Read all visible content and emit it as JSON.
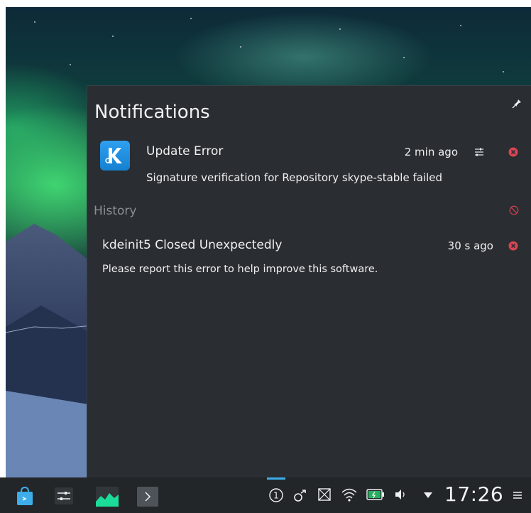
{
  "panel": {
    "title": "Notifications"
  },
  "notifications": [
    {
      "title": "Update Error",
      "time": "2 min ago",
      "body": "Signature verification for Repository skype-stable failed",
      "icon": "kde-discover-icon"
    }
  ],
  "history": {
    "label": "History",
    "items": [
      {
        "title": "kdeinit5 Closed Unexpectedly",
        "time": "30 s ago",
        "body": "Please report this error to help improve this software."
      }
    ]
  },
  "taskbar": {
    "clock": "17:26",
    "launchers": [
      "app-store-icon",
      "settings-sliders-icon",
      "system-monitor-icon",
      "terminal-icon"
    ],
    "tray": [
      "notification-count-icon",
      "kde-connect-icon",
      "clipboard-icon",
      "wifi-icon",
      "battery-icon",
      "volume-icon",
      "expand-tray-icon"
    ],
    "notification_count": "1"
  },
  "colors": {
    "panel_bg": "#2a2d31",
    "taskbar_bg": "#232629",
    "accent": "#3daee9",
    "close_red": "#da4453"
  }
}
